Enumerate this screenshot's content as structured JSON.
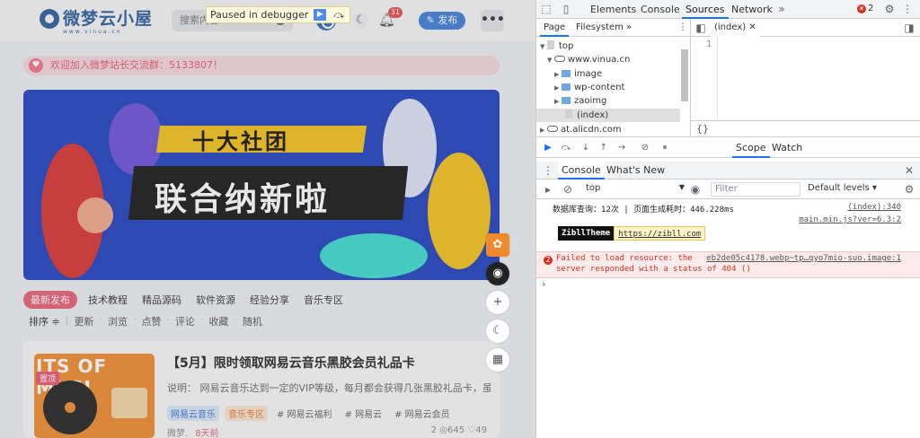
{
  "site": {
    "logo_text": "微梦云小屋",
    "logo_sub": "www.vinua.cn",
    "search_placeholder": "搜索内容",
    "notification_count": "31",
    "publish_label": "发布",
    "more_label": "•••",
    "debugger_label": "Paused in debugger",
    "notice": "欢迎加入微梦站长交流群：5133807！",
    "banner": {
      "line1": "十大社团",
      "line2": "联合纳新啦"
    },
    "tabs": [
      {
        "label": "最新发布",
        "active": true
      },
      {
        "label": "技术教程"
      },
      {
        "label": "精品源码"
      },
      {
        "label": "软件资源"
      },
      {
        "label": "经验分享"
      },
      {
        "label": "音乐专区"
      }
    ],
    "sort_label": "排序 ≑",
    "subtabs": [
      "更新",
      "浏览",
      "点赞",
      "评论",
      "收藏",
      "随机"
    ],
    "card": {
      "thumb_text": "ITS OF MUSI",
      "top_tag": "置顶",
      "title": "【5月】限时领取网易云音乐黑胶会员礼品卡",
      "desc": "说明： 网易云音乐达到一定的VIP等级，每月都会获得几张黑胶礼品卡，虽然天...",
      "tags": [
        {
          "label": "网易云音乐",
          "style": "blue"
        },
        {
          "label": "音乐专区",
          "style": "orange"
        },
        {
          "label": "# 网易云福利",
          "style": "plain"
        },
        {
          "label": "# 网易云",
          "style": "plain"
        },
        {
          "label": "# 网易云会员",
          "style": "plain"
        }
      ],
      "author": "微梦.",
      "time": "8天前",
      "stats": "2  ◎645  ♡49"
    }
  },
  "devtools": {
    "tabs": [
      "Elements",
      "Console",
      "Sources",
      "Network"
    ],
    "active_tab": "Sources",
    "error_count": "2",
    "nav_tabs": [
      "Page",
      "Filesystem"
    ],
    "tree": [
      {
        "label": "top",
        "indent": 0,
        "type": "file"
      },
      {
        "label": "www.vinua.cn",
        "indent": 1,
        "type": "cloud"
      },
      {
        "label": "image",
        "indent": 2,
        "type": "folder"
      },
      {
        "label": "wp-content",
        "indent": 2,
        "type": "folder"
      },
      {
        "label": "zaoimg",
        "indent": 2,
        "type": "folder"
      },
      {
        "label": "(index)",
        "indent": 2,
        "type": "page",
        "selected": true
      },
      {
        "label": "at.alicdn.com",
        "indent": 0,
        "type": "cloud"
      }
    ],
    "editor_tab": "(index)",
    "line_number": "1",
    "editor_footer": "{}",
    "scope_tabs": [
      "Scope",
      "Watch"
    ],
    "drawer_tabs": [
      "Console",
      "What's New"
    ],
    "context": "top",
    "filter_placeholder": "Filter",
    "levels": "Default levels",
    "console": {
      "line1": "数据库查询：12次 | 页面生成耗时：446.228ms",
      "line1_src": "(index):340",
      "line2_src": "main.min.js?ver=6.3:2",
      "zibll_theme": "ZibllTheme",
      "zibll_url": "https://zibll.com",
      "error_count": "2",
      "error_line1": "Failed to load resource: the",
      "error_line2": "server responded with a status of 404 ()",
      "error_src": "eb2de05c4178.webp~tp…qyo7mio-suo.image:1",
      "prompt": "›"
    }
  },
  "colors": {
    "accent": "#1a73e8",
    "brand": "#2a5c9a",
    "error": "#d93025",
    "pink": "#e85d74"
  }
}
